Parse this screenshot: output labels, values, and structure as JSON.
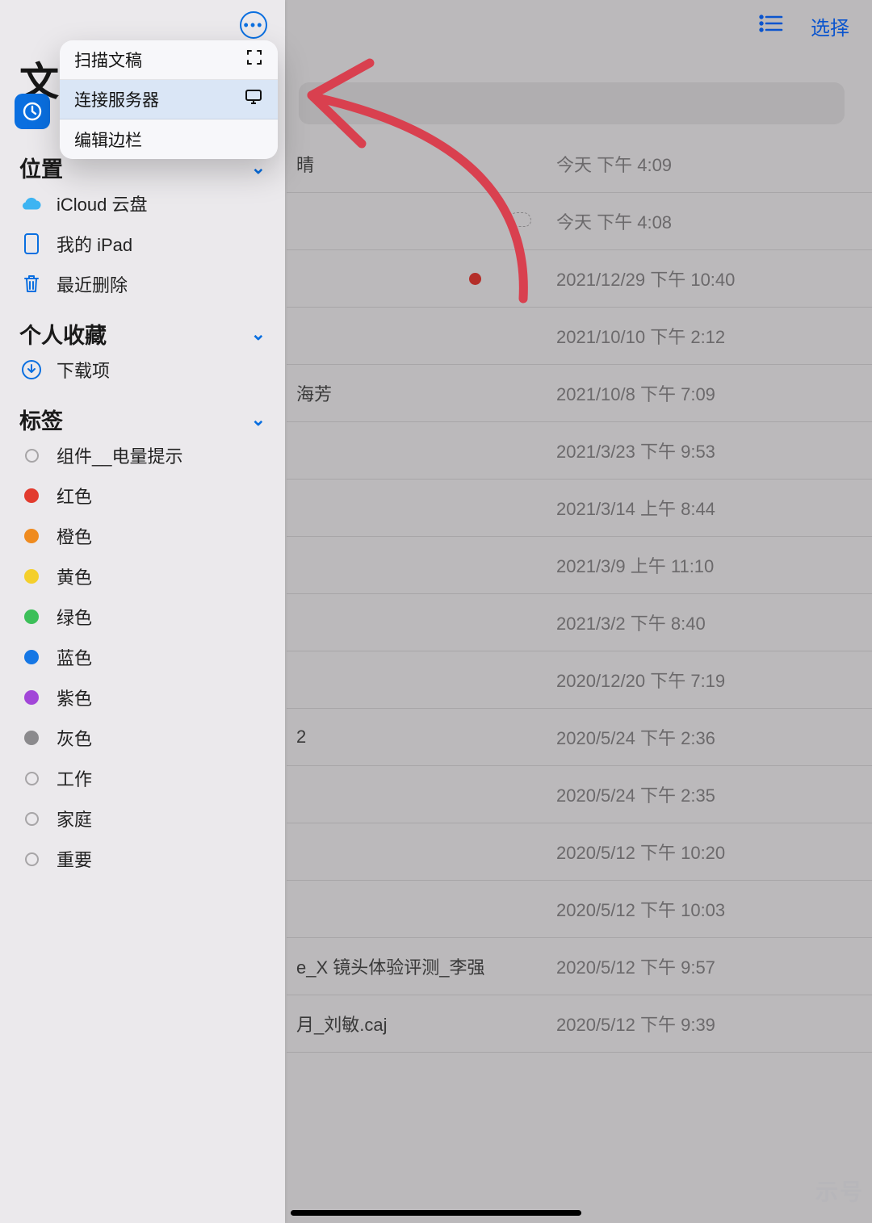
{
  "topbar": {
    "select_label": "选择"
  },
  "sidebar": {
    "title_visible": "文",
    "sections": {
      "locations": {
        "header": "位置",
        "items": [
          {
            "label": "iCloud 云盘",
            "icon": "cloud"
          },
          {
            "label": "我的 iPad",
            "icon": "ipad"
          },
          {
            "label": "最近删除",
            "icon": "trash"
          }
        ]
      },
      "favorites": {
        "header": "个人收藏",
        "items": [
          {
            "label": "下载项",
            "icon": "download"
          }
        ]
      },
      "tags": {
        "header": "标签",
        "items": [
          {
            "label": "组件__电量提示",
            "style": "ring"
          },
          {
            "label": "红色",
            "style": "dot",
            "color": "#e23b2e"
          },
          {
            "label": "橙色",
            "style": "dot",
            "color": "#ef8b1f"
          },
          {
            "label": "黄色",
            "style": "dot",
            "color": "#f4cf2c"
          },
          {
            "label": "绿色",
            "style": "dot",
            "color": "#3cbf59"
          },
          {
            "label": "蓝色",
            "style": "dot",
            "color": "#1577e5"
          },
          {
            "label": "紫色",
            "style": "dot",
            "color": "#a246d8"
          },
          {
            "label": "灰色",
            "style": "dot",
            "color": "#8b8a8d"
          },
          {
            "label": "工作",
            "style": "ring"
          },
          {
            "label": "家庭",
            "style": "ring"
          },
          {
            "label": "重要",
            "style": "ring"
          }
        ]
      }
    }
  },
  "popover": {
    "items": [
      {
        "label": "扫描文稿",
        "icon": "scan"
      },
      {
        "label": "连接服务器",
        "icon": "monitor",
        "highlighted": true
      },
      {
        "label": "编辑边栏",
        "icon": ""
      }
    ]
  },
  "files": [
    {
      "name": "晴",
      "date": "今天 下午 4:09"
    },
    {
      "name": "",
      "date": "今天 下午 4:08",
      "cloud": true
    },
    {
      "name": "",
      "date": "2021/12/29 下午 10:40",
      "red": true
    },
    {
      "name": "",
      "date": "2021/10/10 下午 2:12"
    },
    {
      "name": "海芳",
      "date": "2021/10/8 下午 7:09"
    },
    {
      "name": "",
      "date": "2021/3/23 下午 9:53"
    },
    {
      "name": "",
      "date": "2021/3/14 上午 8:44"
    },
    {
      "name": "",
      "date": "2021/3/9 上午 11:10"
    },
    {
      "name": "",
      "date": "2021/3/2 下午 8:40"
    },
    {
      "name": "",
      "date": "2020/12/20 下午 7:19"
    },
    {
      "name": "2",
      "date": "2020/5/24 下午 2:36"
    },
    {
      "name": "",
      "date": "2020/5/24 下午 2:35"
    },
    {
      "name": "",
      "date": "2020/5/12 下午 10:20"
    },
    {
      "name": "",
      "date": "2020/5/12 下午 10:03"
    },
    {
      "name": "e_X 镜头体验评测_李强",
      "date": "2020/5/12 下午 9:57"
    },
    {
      "name": "月_刘敏.caj",
      "date": "2020/5/12 下午 9:39"
    }
  ],
  "watermark": "示号",
  "colors": {
    "accent": "#0a6fe0",
    "annotation": "#d9404f"
  }
}
